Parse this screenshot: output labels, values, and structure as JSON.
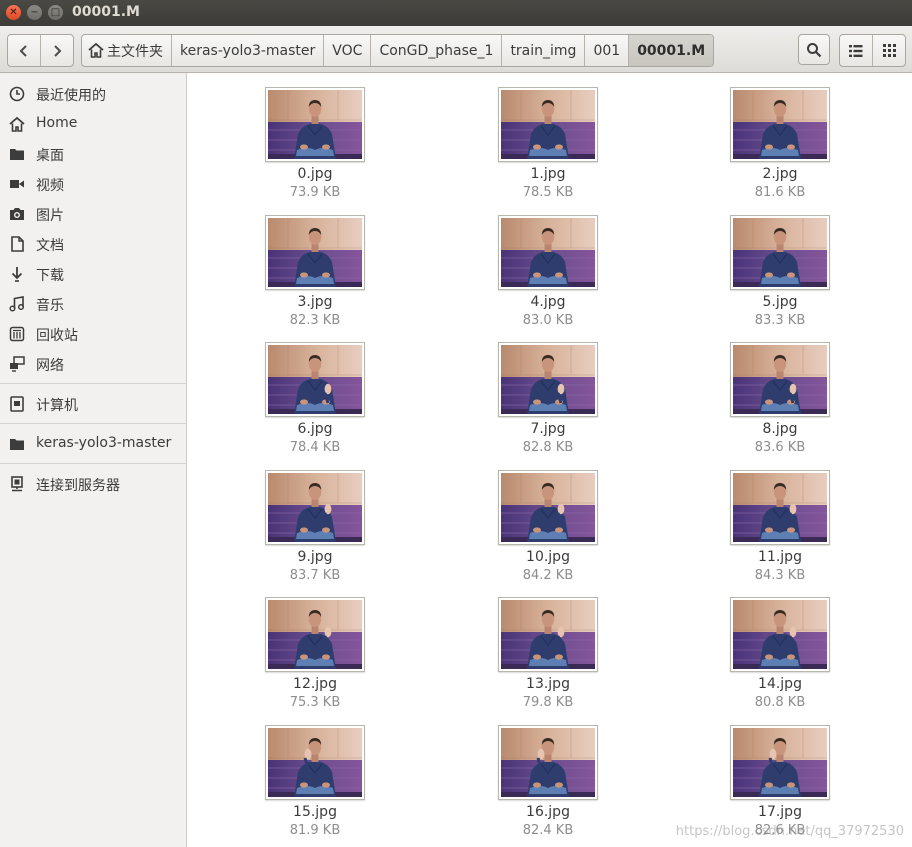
{
  "window": {
    "title": "00001.M"
  },
  "breadcrumbs": [
    {
      "label": "主文件夹"
    },
    {
      "label": "keras-yolo3-master"
    },
    {
      "label": "VOC"
    },
    {
      "label": "ConGD_phase_1"
    },
    {
      "label": "train_img"
    },
    {
      "label": "001"
    },
    {
      "label": "00001.M"
    }
  ],
  "sidebar": {
    "items": [
      {
        "label": "最近使用的",
        "icon": "clock-icon"
      },
      {
        "label": "Home",
        "icon": "home-icon"
      },
      {
        "label": "桌面",
        "icon": "folder-icon"
      },
      {
        "label": "视频",
        "icon": "video-icon"
      },
      {
        "label": "图片",
        "icon": "camera-icon"
      },
      {
        "label": "文档",
        "icon": "document-icon"
      },
      {
        "label": "下载",
        "icon": "download-icon"
      },
      {
        "label": "音乐",
        "icon": "music-icon"
      },
      {
        "label": "回收站",
        "icon": "trash-icon"
      },
      {
        "label": "网络",
        "icon": "network-icon"
      }
    ],
    "devices": [
      {
        "label": "计算机",
        "icon": "computer-icon"
      }
    ],
    "bookmarks": [
      {
        "label": "keras-yolo3-master",
        "icon": "folder-icon"
      }
    ],
    "other": [
      {
        "label": "连接到服务器",
        "icon": "server-icon"
      }
    ]
  },
  "files": [
    {
      "name": "0.jpg",
      "size": "73.9 KB"
    },
    {
      "name": "1.jpg",
      "size": "78.5 KB"
    },
    {
      "name": "2.jpg",
      "size": "81.6 KB"
    },
    {
      "name": "3.jpg",
      "size": "82.3 KB"
    },
    {
      "name": "4.jpg",
      "size": "83.0 KB"
    },
    {
      "name": "5.jpg",
      "size": "83.3 KB"
    },
    {
      "name": "6.jpg",
      "size": "78.4 KB"
    },
    {
      "name": "7.jpg",
      "size": "82.8 KB"
    },
    {
      "name": "8.jpg",
      "size": "83.6 KB"
    },
    {
      "name": "9.jpg",
      "size": "83.7 KB"
    },
    {
      "name": "10.jpg",
      "size": "84.2 KB"
    },
    {
      "name": "11.jpg",
      "size": "84.3 KB"
    },
    {
      "name": "12.jpg",
      "size": "75.3 KB"
    },
    {
      "name": "13.jpg",
      "size": "79.8 KB"
    },
    {
      "name": "14.jpg",
      "size": "80.8 KB"
    },
    {
      "name": "15.jpg",
      "size": "81.9 KB"
    },
    {
      "name": "16.jpg",
      "size": "82.4 KB"
    },
    {
      "name": "17.jpg",
      "size": "82.6 KB"
    }
  ],
  "watermark": "https://blog.csdn.net/qq_37972530",
  "colors": {
    "titlebar": "#3c3b37",
    "close_button": "#e95420",
    "sidebar_bg": "#f2f1f0",
    "toolbar_bg": "#e8e7e4"
  }
}
